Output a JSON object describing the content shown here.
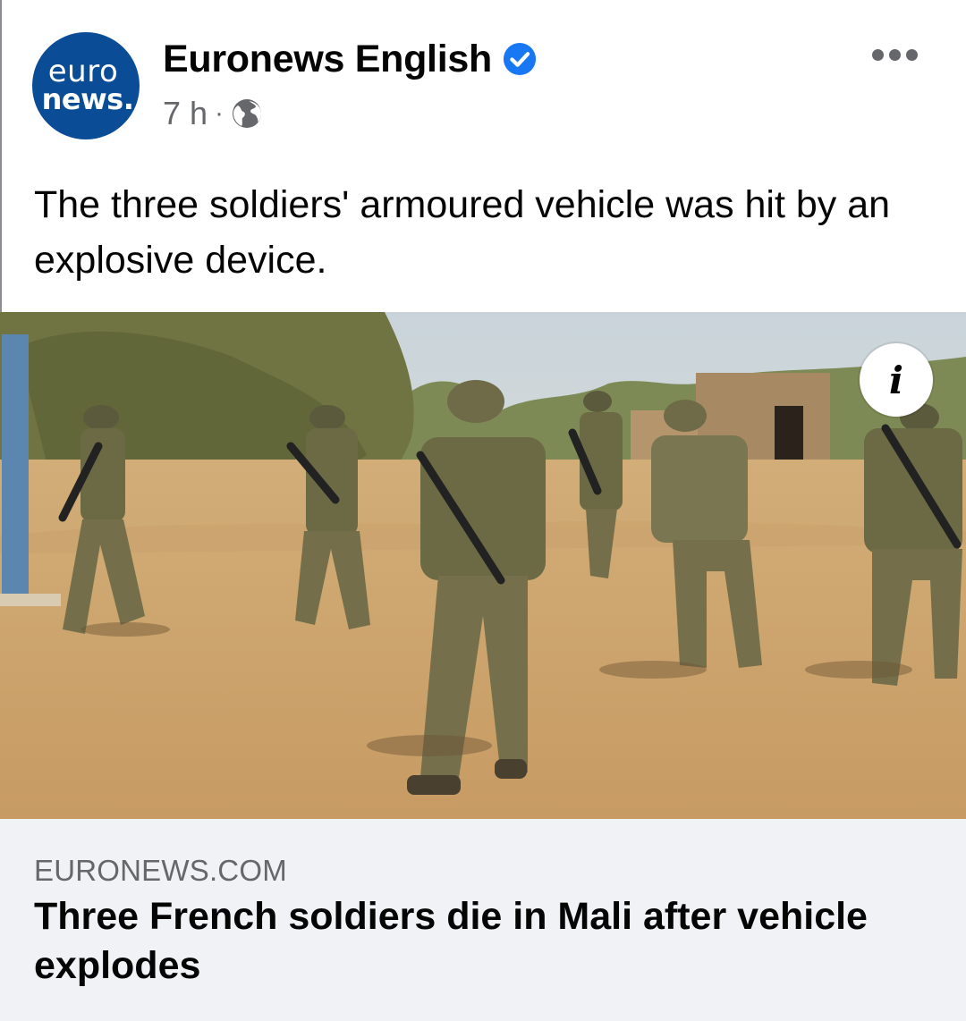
{
  "post": {
    "page_name": "Euronews English",
    "avatar": {
      "line1": "euro",
      "line2": "news.",
      "color": "#0a4c96"
    },
    "verified_icon": "verified-badge-icon",
    "timestamp": "7 h",
    "separator": "·",
    "audience_icon": "globe-icon",
    "more_icon": "more-options-icon",
    "text": "The three soldiers' armoured vehicle was hit by an explosive device."
  },
  "media": {
    "info_label": "i"
  },
  "link_preview": {
    "domain": "EURONEWS.COM",
    "title": "Three French soldiers die in Mali after vehicle explodes"
  },
  "colors": {
    "verified": "#1877f2",
    "secondary_text": "#65676b",
    "link_bg": "#f0f2f5"
  }
}
